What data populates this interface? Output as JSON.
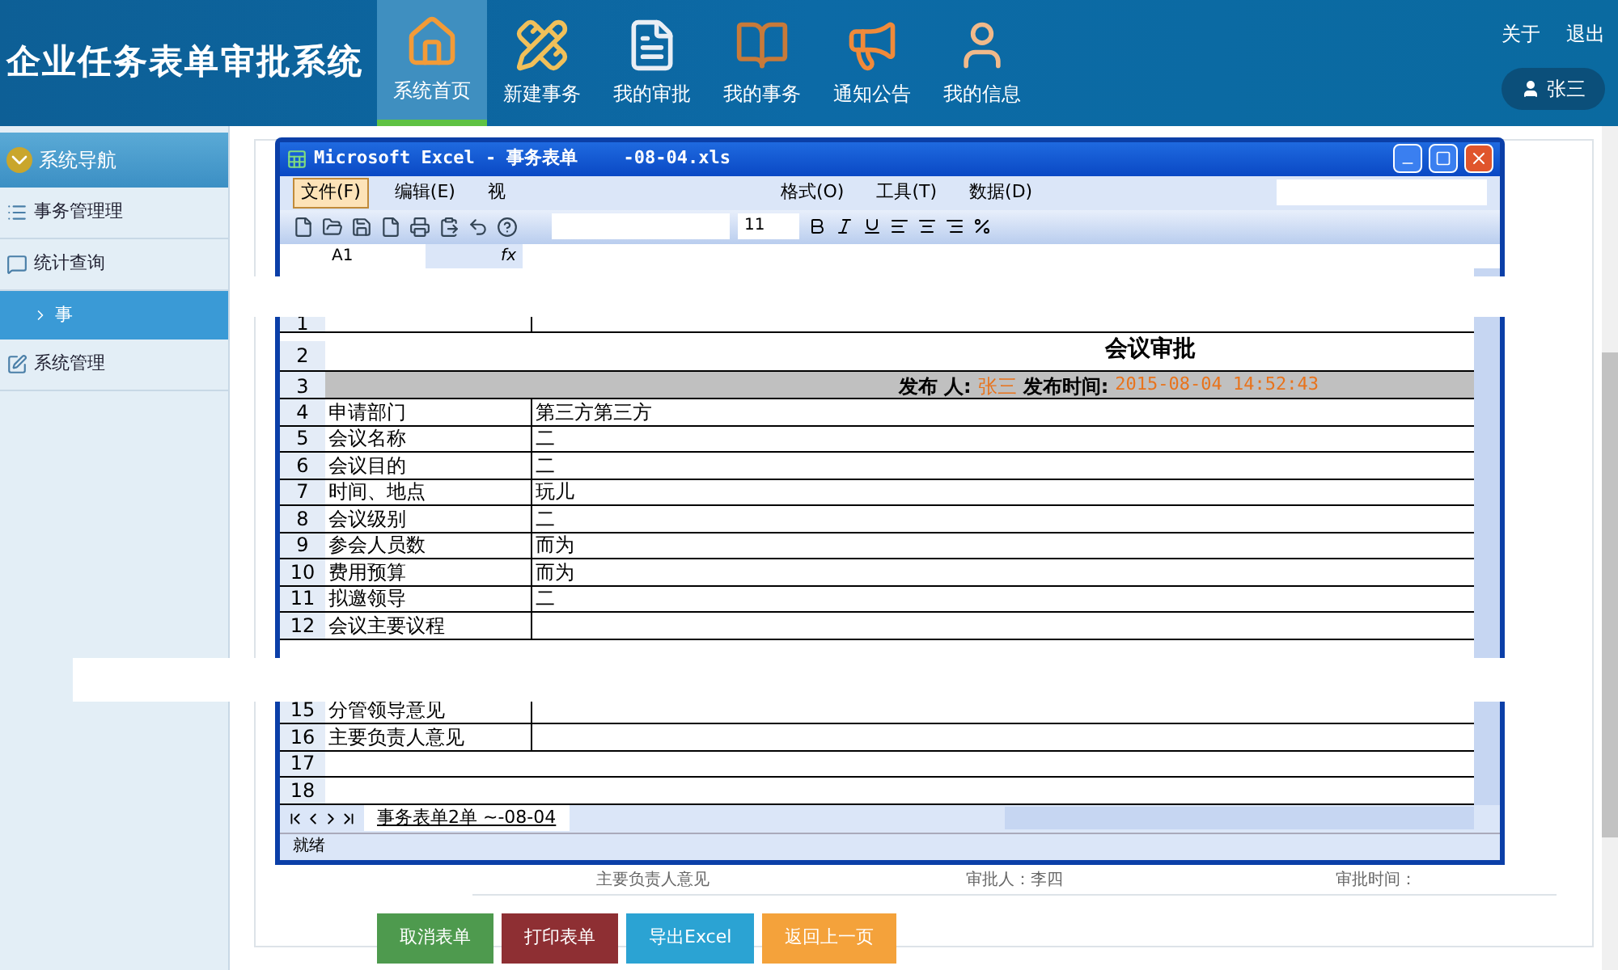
{
  "header": {
    "title": "企业任务表单审批系统",
    "nav": [
      {
        "label": "系统首页",
        "selected": true,
        "kind": "home"
      },
      {
        "label": "新建事务",
        "selected": false,
        "kind": "new"
      },
      {
        "label": "我的审批",
        "selected": false,
        "kind": "doc"
      },
      {
        "label": "我的事务",
        "selected": false,
        "kind": "book"
      },
      {
        "label": "通知公告",
        "selected": false,
        "kind": "notice"
      },
      {
        "label": "我的信息",
        "selected": false,
        "kind": "user"
      }
    ],
    "links": [
      "关于",
      "退出"
    ],
    "user": "张三"
  },
  "sidebar": {
    "title": "系统导航",
    "items": [
      {
        "label": "事务管理理",
        "kind": "list",
        "selected": false
      },
      {
        "label": "统计查询",
        "kind": "chat",
        "selected": false,
        "children": [
          {
            "label": "事",
            "selected": true
          }
        ]
      },
      {
        "label": "系统管理",
        "kind": "edit",
        "selected": false
      }
    ]
  },
  "background_form": {
    "cells": [
      "主要负责人意见",
      "审批人：李四",
      "审批时间："
    ]
  },
  "excel": {
    "title": "Microsoft Excel - 事务表单",
    "title_suffix": "-08-04.xls",
    "menu": [
      {
        "label": "文件(F)",
        "selected": true
      },
      {
        "label": "编辑(E)",
        "selected": false
      },
      {
        "label": "视",
        "selected": false
      },
      {
        "label": "格式(O)",
        "selected": false
      },
      {
        "label": "工具(T)",
        "selected": false
      },
      {
        "label": "数据(D)",
        "selected": false
      }
    ],
    "font_size": "11",
    "cell_ref": "A1",
    "formula_label": "fx",
    "sheet": {
      "top_row_numbers": [
        "1",
        "2",
        "3"
      ],
      "heading": "会议审批",
      "publisher_label": "发布 人:",
      "publisher": "张三",
      "time_label": "发布时间:",
      "time": "2015-08-04 14:52:43",
      "rows": [
        {
          "num": "4",
          "label": "申请部门",
          "value": "第三方第三方"
        },
        {
          "num": "5",
          "label": "会议名称",
          "value": "二"
        },
        {
          "num": "6",
          "label": "会议目的",
          "value": "二"
        },
        {
          "num": "7",
          "label": "时间、地点",
          "value": "玩儿"
        },
        {
          "num": "8",
          "label": "会议级别",
          "value": "二"
        },
        {
          "num": "9",
          "label": "参会人员数",
          "value": "而为"
        },
        {
          "num": "10",
          "label": "费用预算",
          "value": "而为"
        },
        {
          "num": "11",
          "label": "拟邀领导",
          "value": "二"
        },
        {
          "num": "12",
          "label": "会议主要议程"
        }
      ],
      "lower_rows": [
        {
          "num": "15",
          "label": "分管领导意见"
        },
        {
          "num": "16",
          "label": "主要负责人意见"
        },
        {
          "num": "17"
        },
        {
          "num": "18"
        }
      ]
    },
    "sheet_tab": "事务表单2单 ~-08-04",
    "status": "就绪"
  },
  "buttons": [
    {
      "label": "取消表单",
      "color": "#4e9a4e"
    },
    {
      "label": "打印表单",
      "color": "#8e2f33"
    },
    {
      "label": "导出Excel",
      "color": "#2ba3d3"
    },
    {
      "label": "返回上一页",
      "color": "#f4a23b"
    }
  ]
}
